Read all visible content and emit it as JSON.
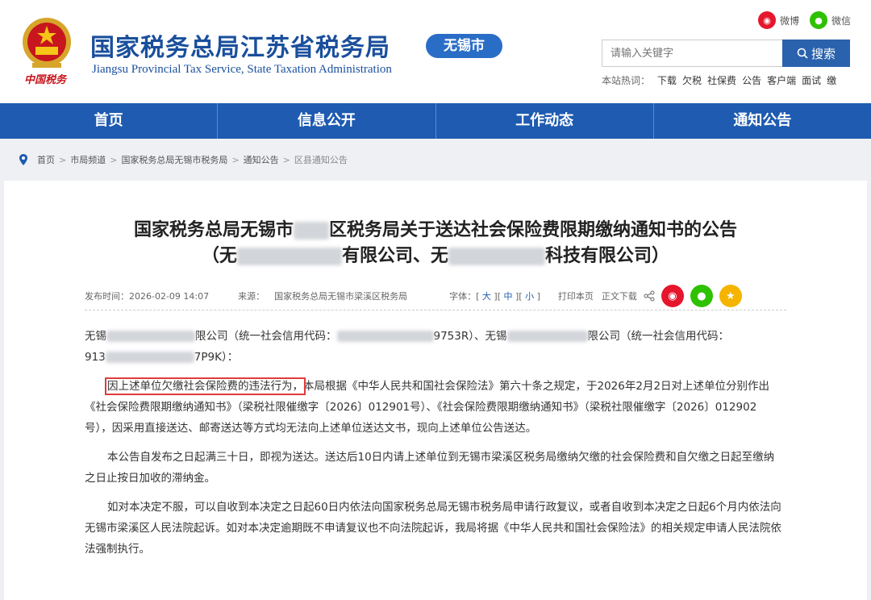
{
  "header": {
    "title": "国家税务总局江苏省税务局",
    "subtitle": "Jiangsu Provincial Tax Service, State Taxation Administration",
    "city_badge": "无锡市",
    "emblem_text": "中国税务",
    "social": [
      {
        "label": "微博",
        "icon": "weibo-icon",
        "color": "#e6162d"
      },
      {
        "label": "微信",
        "icon": "wechat-icon",
        "color": "#2ec100"
      }
    ],
    "search": {
      "placeholder": "请输入关键字",
      "button": "搜索"
    },
    "hotwords_label": "本站热词：",
    "hotwords": [
      "下载",
      "欠税",
      "社保费",
      "公告",
      "客户端",
      "面试",
      "缴"
    ]
  },
  "nav": [
    "首页",
    "信息公开",
    "工作动态",
    "通知公告"
  ],
  "breadcrumb": [
    "首页",
    "市局频道",
    "国家税务总局无锡市税务局",
    "通知公告",
    "区县通知公告"
  ],
  "article": {
    "title_line1": {
      "a": "国家税务总局无锡市",
      "b": "区税务局关于送达社会保险费限期缴纳通知书的公告"
    },
    "title_line2": {
      "a": "（无",
      "b": "有限公司、无",
      "c": "科技有限公司）"
    },
    "meta": {
      "date_label": "发布时间：",
      "date": "2026-02-09 14:07",
      "source_label": "来源：",
      "source": "国家税务总局无锡市梁溪区税务局",
      "font_label": "字体：",
      "font_large": "大",
      "font_mid": "中",
      "font_small": "小",
      "print": "打印本页",
      "download": "正文下载"
    },
    "p1": {
      "a": "无锡",
      "b": "限公司（统一社会信用代码：",
      "c": "9753R）、无锡",
      "d": "限公司（统一社会信用代码：",
      "e": "913",
      "f": "7P9K）："
    },
    "p2_highlight": "因上述单位欠缴社会保险费的违法行为，",
    "p2_rest": "本局根据《中华人民共和国社会保险法》第六十条之规定，于2026年2月2日对上述单位分别作出《社会保险费限期缴纳通知书》（梁税社限催缴字〔2026〕012901号）、《社会保险费限期缴纳通知书》（梁税社限催缴字〔2026〕012902号），因采用直接送达、邮寄送达等方式均无法向上述单位送达文书，现向上述单位公告送达。",
    "p3": "本公告自发布之日起满三十日，即视为送达。送达后10日内请上述单位到无锡市梁溪区税务局缴纳欠缴的社会保险费和自欠缴之日起至缴纳之日止按日加收的滞纳金。",
    "p4": "如对本决定不服，可以自收到本决定之日起60日内依法向国家税务总局无锡市税务局申请行政复议，或者自收到本决定之日起6个月内依法向无锡市梁溪区人民法院起诉。如对本决定逾期既不申请复议也不向法院起诉，我局将据《中华人民共和国社会保险法》的相关规定申请人民法院依法强制执行。"
  },
  "colors": {
    "brand": "#1a4f9c",
    "nav": "#1e5bb1",
    "highlight_border": "#e03c3c"
  }
}
